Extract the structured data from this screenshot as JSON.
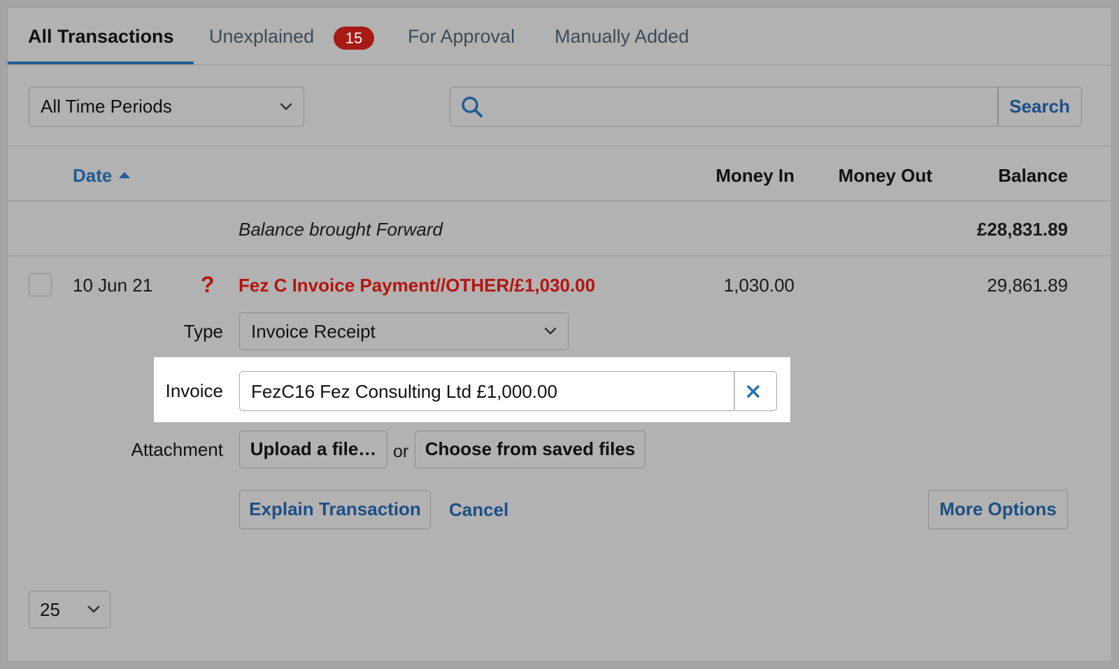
{
  "tabs": [
    {
      "label": "All Transactions",
      "active": true
    },
    {
      "label": "Unexplained",
      "badge": "15"
    },
    {
      "label": "For Approval"
    },
    {
      "label": "Manually Added"
    }
  ],
  "filters": {
    "period": "All Time Periods",
    "search_button": "Search",
    "search_value": ""
  },
  "table": {
    "headers": {
      "date": "Date",
      "money_in": "Money In",
      "money_out": "Money Out",
      "balance": "Balance"
    },
    "brought_forward": {
      "label": "Balance brought Forward",
      "balance": "£28,831.89"
    },
    "row": {
      "date": "10 Jun 21",
      "status_icon": "?",
      "description": "Fez C Invoice Payment//OTHER/£1,030.00",
      "money_in": "1,030.00",
      "balance": "29,861.89"
    }
  },
  "explain_form": {
    "type_label": "Type",
    "type_value": "Invoice Receipt",
    "invoice_label": "Invoice",
    "invoice_value": "FezC16 Fez Consulting Ltd £1,000.00",
    "attachment_label": "Attachment",
    "upload_button": "Upload a file…",
    "or_text": "or",
    "saved_files_button": "Choose from saved files",
    "explain_button": "Explain Transaction",
    "cancel_link": "Cancel",
    "more_options_button": "More Options"
  },
  "pagination": {
    "per_page": "25"
  },
  "colors": {
    "accent": "#1f5c96",
    "danger": "#b4140f",
    "badge": "#a81a14",
    "highlight": "#ffffff"
  }
}
